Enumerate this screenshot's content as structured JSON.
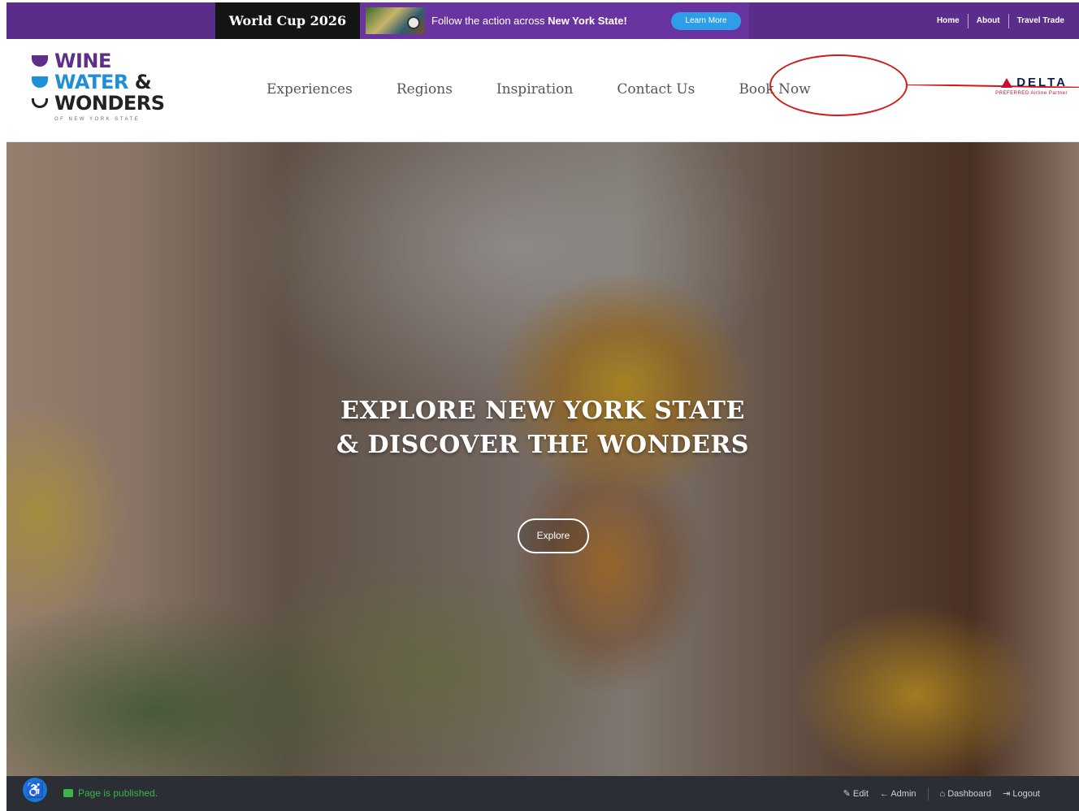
{
  "promo": {
    "title": "World Cup 2026",
    "text_prefix": "Follow the action across",
    "text_bold": "New York State!",
    "button": "Learn More"
  },
  "utility_links": [
    "Home",
    "About",
    "Travel Trade"
  ],
  "logo": {
    "line1": "WINE",
    "line2": "WATER",
    "amp": "&",
    "line3": "WONDERS",
    "sub": "OF NEW YORK STATE"
  },
  "nav": {
    "experiences": "Experiences",
    "regions": "Regions",
    "inspiration": "Inspiration",
    "contact": "Contact Us",
    "book": "Book Now"
  },
  "partner": {
    "name": "DELTA",
    "tagline": "PREFERRED Airline Partner"
  },
  "hero": {
    "title_line1": "EXPLORE NEW YORK STATE",
    "title_line2": "& DISCOVER THE WONDERS",
    "button": "Explore"
  },
  "adminbar": {
    "status": "Page is published.",
    "edit": "Edit",
    "admin": "Admin",
    "dashboard": "Dashboard",
    "logout": "Logout"
  },
  "colors": {
    "brand_purple": "#5a2d8a",
    "brand_blue": "#1f8fd6",
    "annotation_red": "#d11a1a",
    "admin_bar": "#2b2f35"
  }
}
